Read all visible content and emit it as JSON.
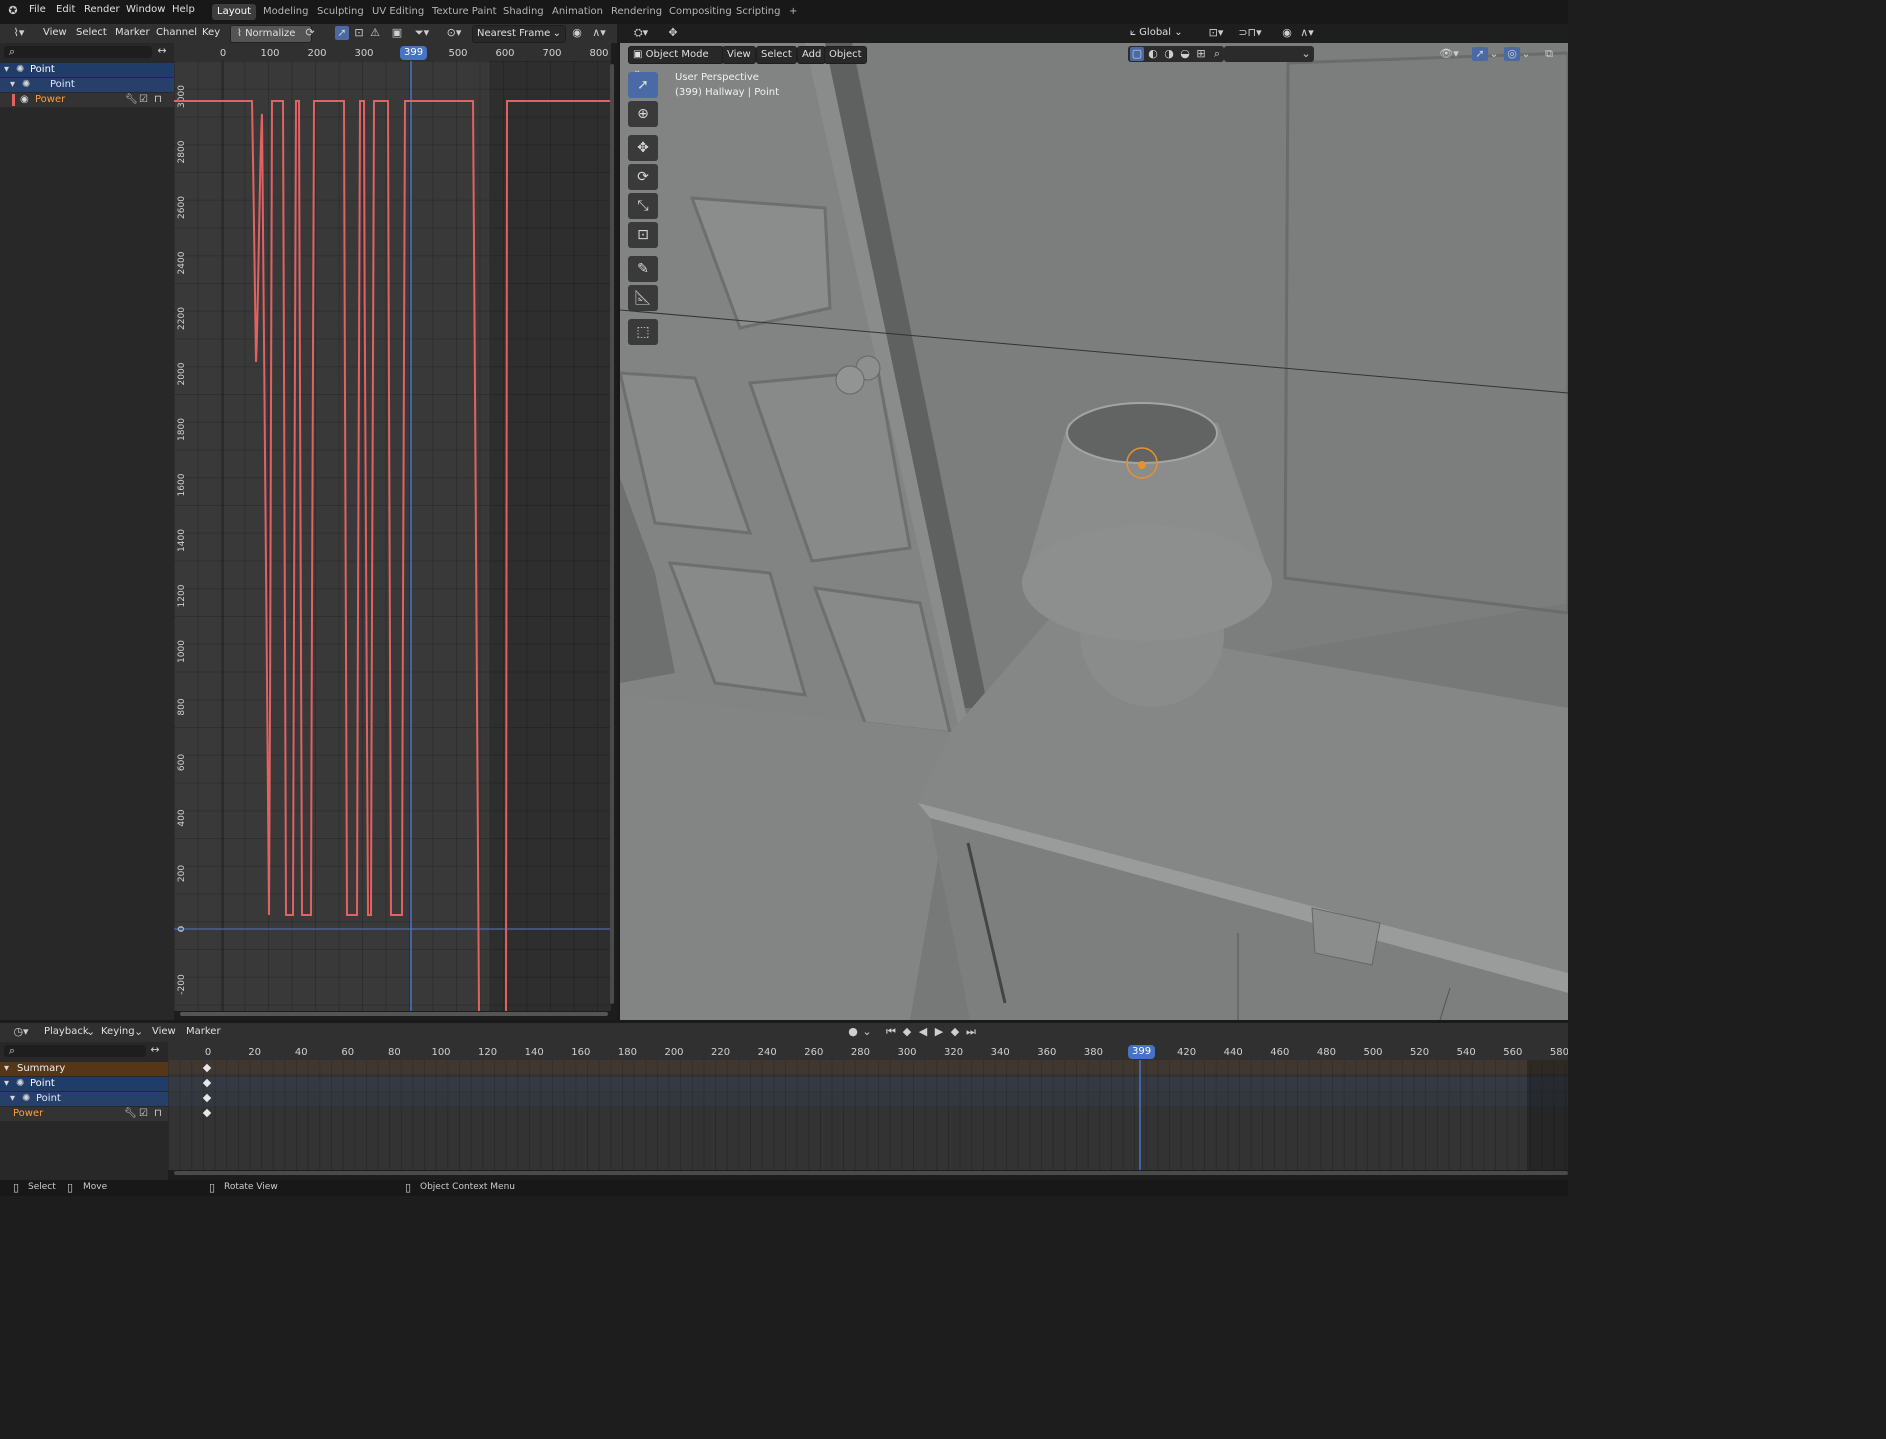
{
  "topbar": {
    "menus": [
      "File",
      "Edit",
      "Render",
      "Window",
      "Help"
    ],
    "workspaces": [
      "Layout",
      "Modeling",
      "Sculpting",
      "UV Editing",
      "Texture Paint",
      "Shading",
      "Animation",
      "Rendering",
      "Compositing",
      "Scripting"
    ],
    "active_workspace": "Layout",
    "add_tab": "+"
  },
  "graph": {
    "menus": [
      "View",
      "Select",
      "Marker",
      "Channel",
      "Key"
    ],
    "normalize": "Normalize",
    "snap": "Nearest Frame",
    "current_frame": "399",
    "x_ticks": [
      "0",
      "100",
      "200",
      "300",
      "400",
      "500",
      "600",
      "700",
      "800"
    ],
    "y_ticks": [
      "3000",
      "2800",
      "2600",
      "2400",
      "2200",
      "2000",
      "1800",
      "1600",
      "1400",
      "1200",
      "1000",
      "800",
      "600",
      "400",
      "200",
      "0",
      "-200"
    ],
    "channels": [
      {
        "label": "Point",
        "level": 0
      },
      {
        "label": "Point",
        "level": 1
      },
      {
        "label": "Power",
        "level": 2
      }
    ],
    "curve_color": "#e16262"
  },
  "viewport": {
    "mode": "Object Mode",
    "menus": [
      "View",
      "Select",
      "Add",
      "Object"
    ],
    "transform": "Global",
    "overlay_title": "User Perspective",
    "overlay_sub": "(399) Hallway | Point"
  },
  "timeline": {
    "menus": [
      "Playback",
      "Keying",
      "View",
      "Marker"
    ],
    "current_frame": "399",
    "ticks": [
      "0",
      "20",
      "40",
      "60",
      "80",
      "100",
      "120",
      "140",
      "160",
      "180",
      "200",
      "220",
      "240",
      "260",
      "280",
      "300",
      "320",
      "340",
      "360",
      "380",
      "420",
      "440",
      "460",
      "480",
      "500",
      "520",
      "540",
      "560",
      "580"
    ],
    "rows": [
      {
        "label": "Summary",
        "kind": "summary"
      },
      {
        "label": "Point",
        "kind": "object"
      },
      {
        "label": "Point",
        "kind": "data"
      },
      {
        "label": "Power",
        "kind": "channel"
      }
    ]
  },
  "statusbar": {
    "select": "Select",
    "move": "Move",
    "rotate": "Rotate View",
    "context": "Object Context Menu"
  },
  "colors": {
    "accent": "#4773c4",
    "curve": "#e16262",
    "active_channel": "#ff9f3b"
  }
}
